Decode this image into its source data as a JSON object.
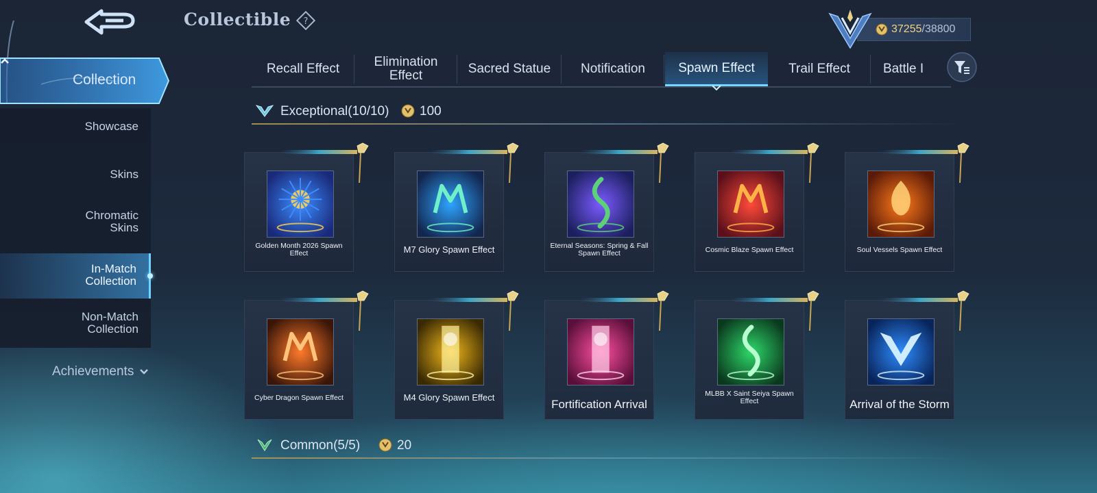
{
  "header": {
    "title": "Collectible",
    "currency_current": "37255",
    "currency_separator": "/",
    "currency_max": "38800"
  },
  "sidebar": {
    "collection_label": "Collection",
    "items": [
      {
        "label": "Showcase",
        "active": false
      },
      {
        "label": "Skins",
        "active": false
      },
      {
        "label": "Chromatic Skins",
        "active": false
      },
      {
        "label": "In-Match Collection",
        "active": true
      },
      {
        "label": "Non-Match Collection",
        "active": false
      }
    ],
    "achievements_label": "Achievements"
  },
  "tabs": [
    {
      "label": "Recall Effect",
      "active": false
    },
    {
      "label": "Elimination Effect",
      "active": false
    },
    {
      "label": "Sacred Statue",
      "active": false
    },
    {
      "label": "Notification",
      "active": false
    },
    {
      "label": "Spawn Effect",
      "active": true
    },
    {
      "label": "Trail Effect",
      "active": false
    },
    {
      "label": "Battle I",
      "active": false
    }
  ],
  "sections": [
    {
      "name": "Exceptional(10/10)",
      "price": "100"
    },
    {
      "name": "Common(5/5)",
      "price": "20"
    }
  ],
  "items": [
    {
      "name": "Golden Month 2026 Spawn Effect"
    },
    {
      "name": "M7 Glory Spawn Effect"
    },
    {
      "name": "Eternal Seasons: Spring & Fall Spawn Effect"
    },
    {
      "name": "Cosmic Blaze Spawn Effect"
    },
    {
      "name": "Soul Vessels Spawn Effect"
    },
    {
      "name": "Cyber Dragon Spawn Effect"
    },
    {
      "name": "M4 Glory Spawn Effect"
    },
    {
      "name": "Fortification Arrival"
    },
    {
      "name": "MLBB X Saint Seiya Spawn Effect"
    },
    {
      "name": "Arrival of the Storm"
    }
  ],
  "colors": {
    "accent": "#78d7ff",
    "gold": "#f0d38a"
  }
}
